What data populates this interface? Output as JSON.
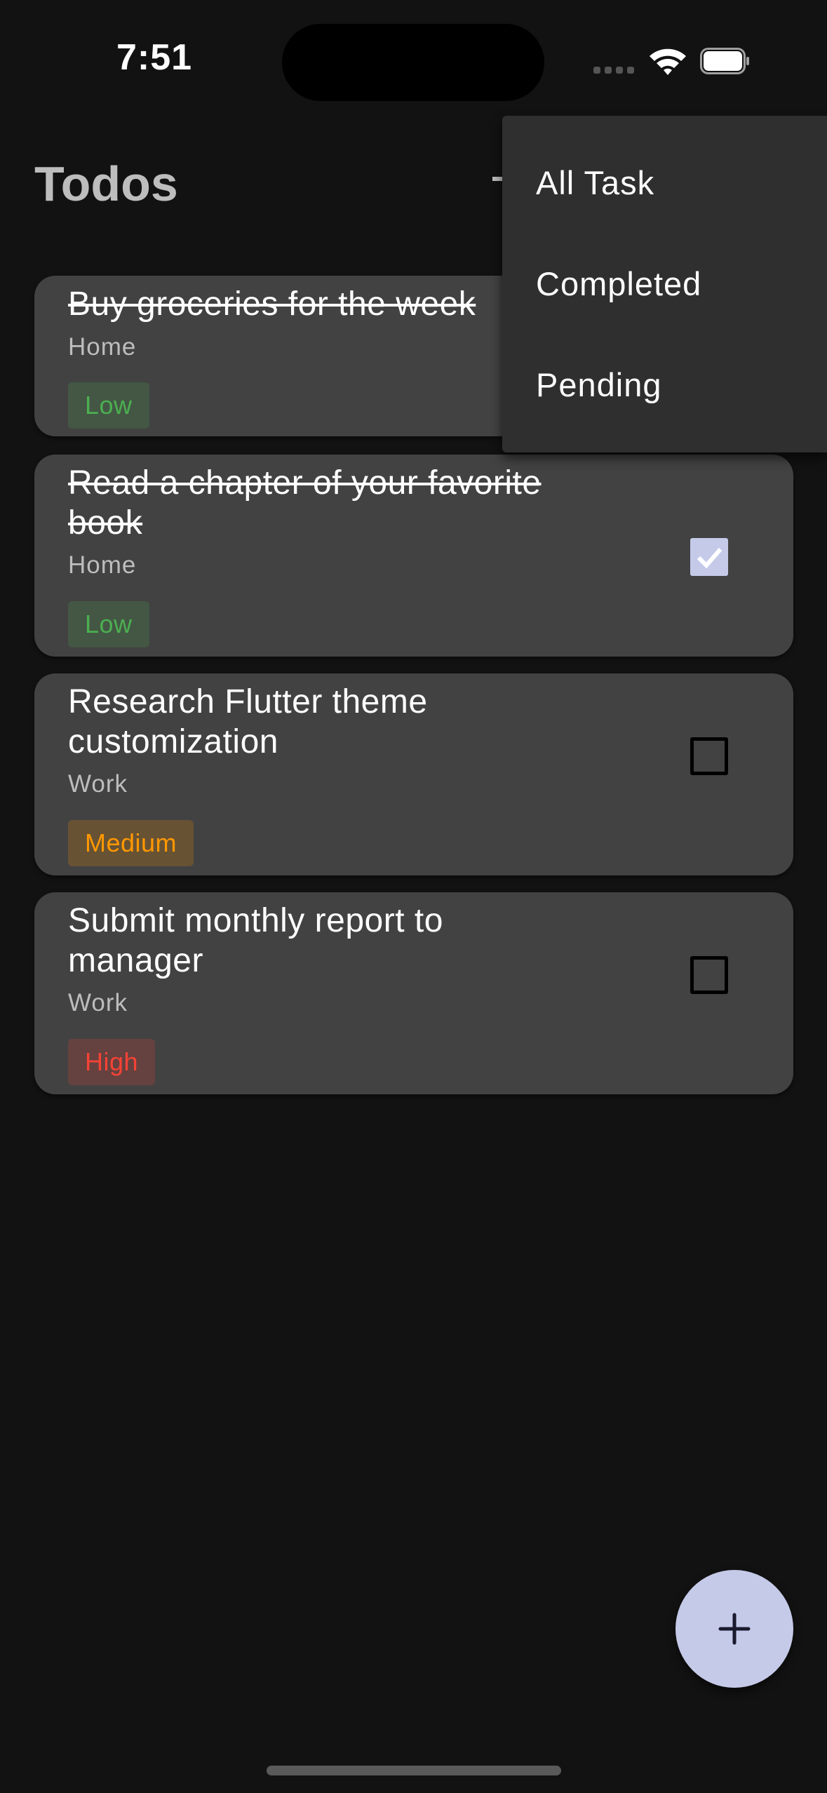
{
  "status_bar": {
    "time": "7:51"
  },
  "header": {
    "title": "Todos"
  },
  "todos": [
    {
      "title": "Buy groceries for the week",
      "category": "Home",
      "priority": "Low",
      "completed": true
    },
    {
      "title": "Read a chapter of your favorite book",
      "category": "Home",
      "priority": "Low",
      "completed": true
    },
    {
      "title": "Research Flutter theme customization",
      "category": "Work",
      "priority": "Medium",
      "completed": false
    },
    {
      "title": "Submit monthly report to manager",
      "category": "Work",
      "priority": "High",
      "completed": false
    }
  ],
  "filter_menu": {
    "items": [
      "All Task",
      "Completed",
      "Pending"
    ]
  },
  "fab": {
    "icon": "plus-icon"
  },
  "colors": {
    "background": "#121212",
    "card": "#424242",
    "menu": "#2f2f2f",
    "accent": "#c5cae9",
    "low": "#4caf50",
    "medium": "#ff9800",
    "high": "#f44336"
  }
}
